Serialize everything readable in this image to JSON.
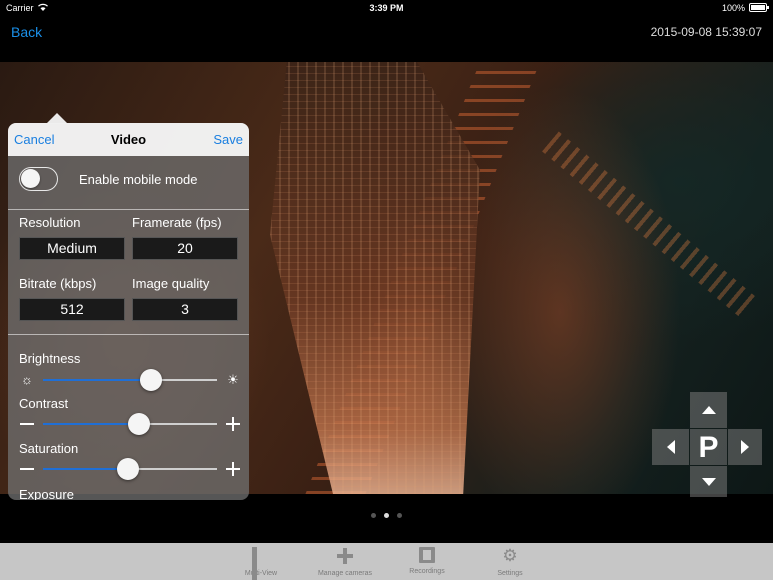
{
  "status_bar": {
    "carrier": "Carrier",
    "time": "3:39 PM",
    "battery": "100%"
  },
  "nav": {
    "back_label": "Back",
    "timestamp": "2015-09-08 15:39:07"
  },
  "ptz": {
    "center_label": "P"
  },
  "video_popover": {
    "cancel_label": "Cancel",
    "title": "Video",
    "save_label": "Save",
    "mobile_mode": {
      "label": "Enable mobile mode",
      "enabled": false
    },
    "fields": {
      "resolution": {
        "label": "Resolution",
        "value": "Medium"
      },
      "framerate": {
        "label": "Framerate (fps)",
        "value": "20"
      },
      "bitrate": {
        "label": "Bitrate (kbps)",
        "value": "512"
      },
      "image_quality": {
        "label": "Image quality",
        "value": "3"
      }
    },
    "sliders": [
      {
        "label": "Brightness",
        "level": 0.62,
        "left_icon": "brightness-low-icon",
        "right_icon": "brightness-high-icon"
      },
      {
        "label": "Contrast",
        "level": 0.55,
        "left_icon": "minus-icon",
        "right_icon": "plus-icon"
      },
      {
        "label": "Saturation",
        "level": 0.49,
        "left_icon": "minus-icon",
        "right_icon": "plus-icon"
      }
    ],
    "exposure_label": "Exposure"
  },
  "pager": {
    "pages": 3,
    "active": 1
  },
  "tab_bar": {
    "tabs": [
      {
        "label": "Multi-View",
        "icon": "grid-icon"
      },
      {
        "label": "Manage cameras",
        "icon": "plus-icon"
      },
      {
        "label": "Recordings",
        "icon": "film-icon"
      },
      {
        "label": "Settings",
        "icon": "gear-icon"
      }
    ]
  },
  "colors": {
    "accent": "#1a7fe0",
    "slider_fill": "#1f6fd6",
    "tabbar_bg": "#c6c6c6"
  }
}
